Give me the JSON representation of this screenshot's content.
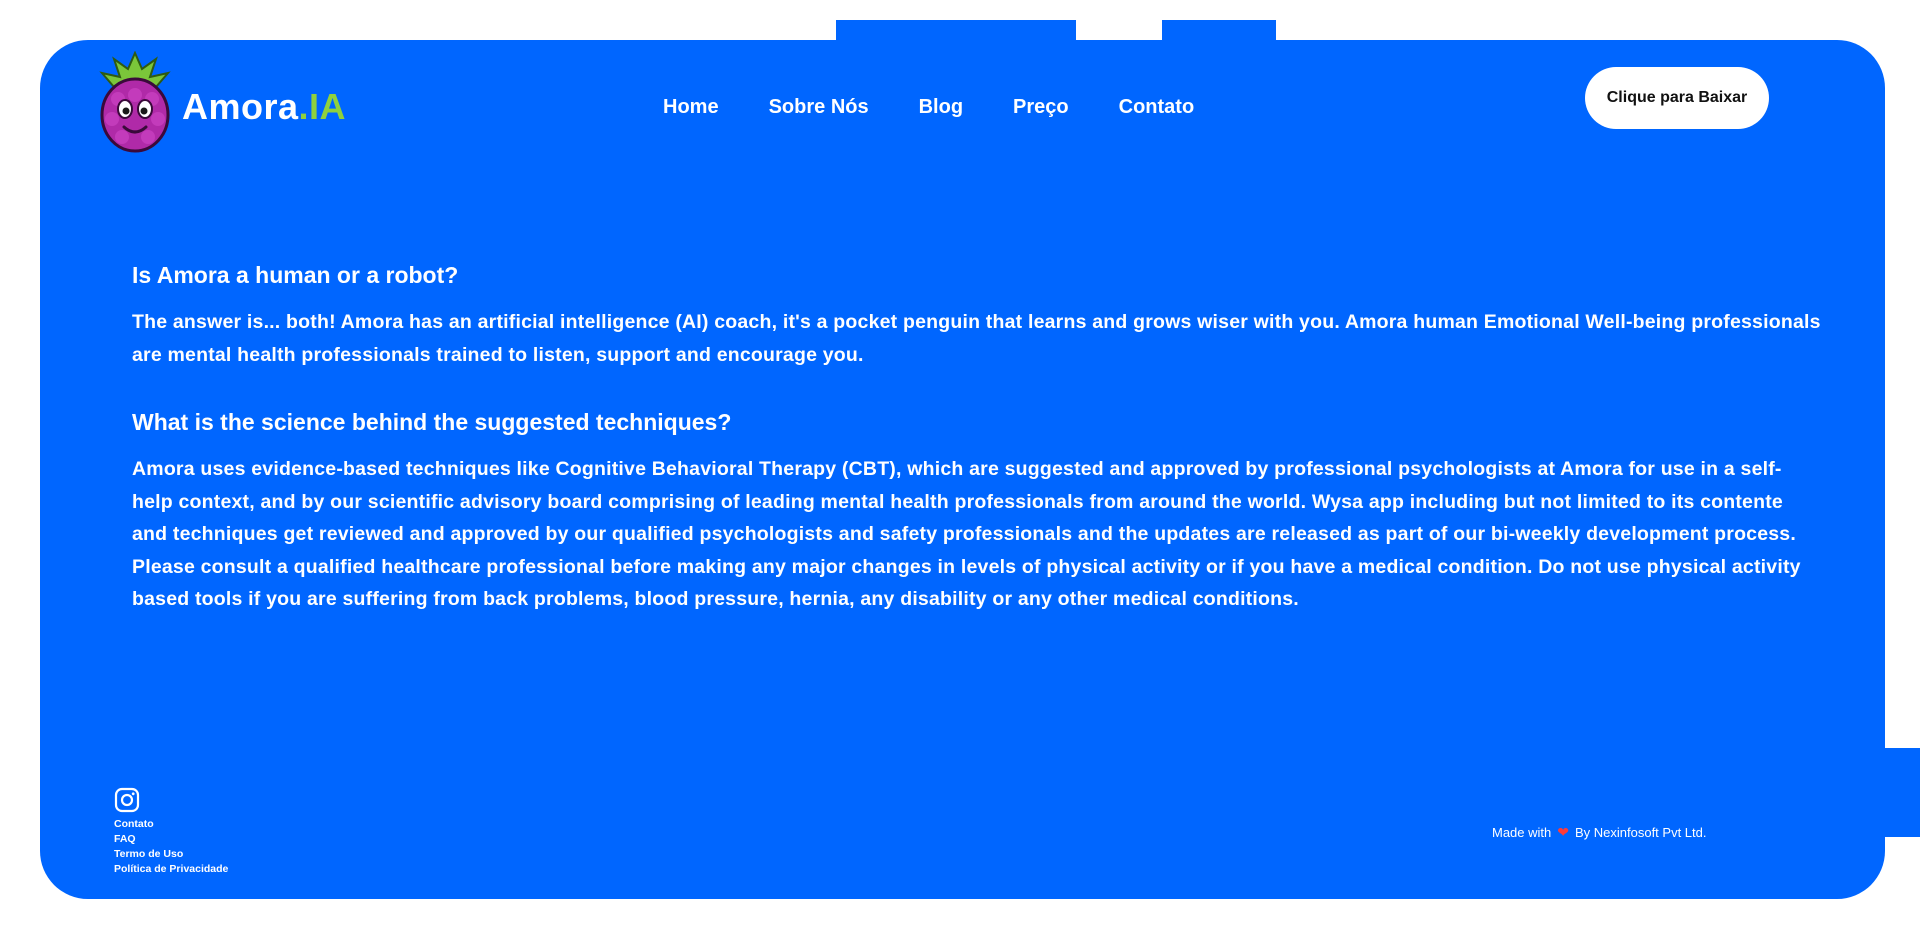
{
  "brand": {
    "name_main": "Amora",
    "name_accent": ".IA",
    "accent_color": "#8fd13d",
    "primary_color": "#0066ff",
    "logo_icon": "raspberry-mascot-icon"
  },
  "nav": {
    "items": [
      {
        "label": "Home"
      },
      {
        "label": "Sobre Nós"
      },
      {
        "label": "Blog"
      },
      {
        "label": "Preço"
      },
      {
        "label": "Contato"
      }
    ]
  },
  "cta": {
    "label": "Clique para Baixar"
  },
  "faq": [
    {
      "question": "Is Amora a human or a robot?",
      "answer": "The answer is... both! Amora has an artificial intelligence (AI) coach, it's a pocket penguin that learns and grows wiser with you. Amora human Emotional Well-being professionals are mental health professionals trained to listen, support and encourage you."
    },
    {
      "question": "What is the science behind the suggested techniques?",
      "answer": "Amora uses evidence-based techniques like Cognitive Behavioral Therapy (CBT), which are suggested and approved by professional psychologists at Amora for use in a self-help context, and by our scientific advisory board comprising of leading mental health professionals from around the world. Wysa app including but not limited to its contente and techniques get reviewed and approved by our qualified psychologists and safety professionals and the updates are released as part of our bi-weekly development process. Please consult a qualified healthcare professional before making any major changes in levels of physical activity or if you have a medical condition. Do not use physical activity based tools if you are suffering from back problems, blood pressure, hernia, any disability or any other medical conditions."
    }
  ],
  "footer": {
    "social_icon": "instagram-icon",
    "links": [
      {
        "label": "Contato"
      },
      {
        "label": "FAQ"
      },
      {
        "label": "Termo de Uso"
      },
      {
        "label": "Política de Privacidade"
      }
    ],
    "made_with_prefix": "Made with",
    "heart_icon": "heart-icon",
    "made_with_suffix": "By Nexinfosoft Pvt Ltd."
  }
}
